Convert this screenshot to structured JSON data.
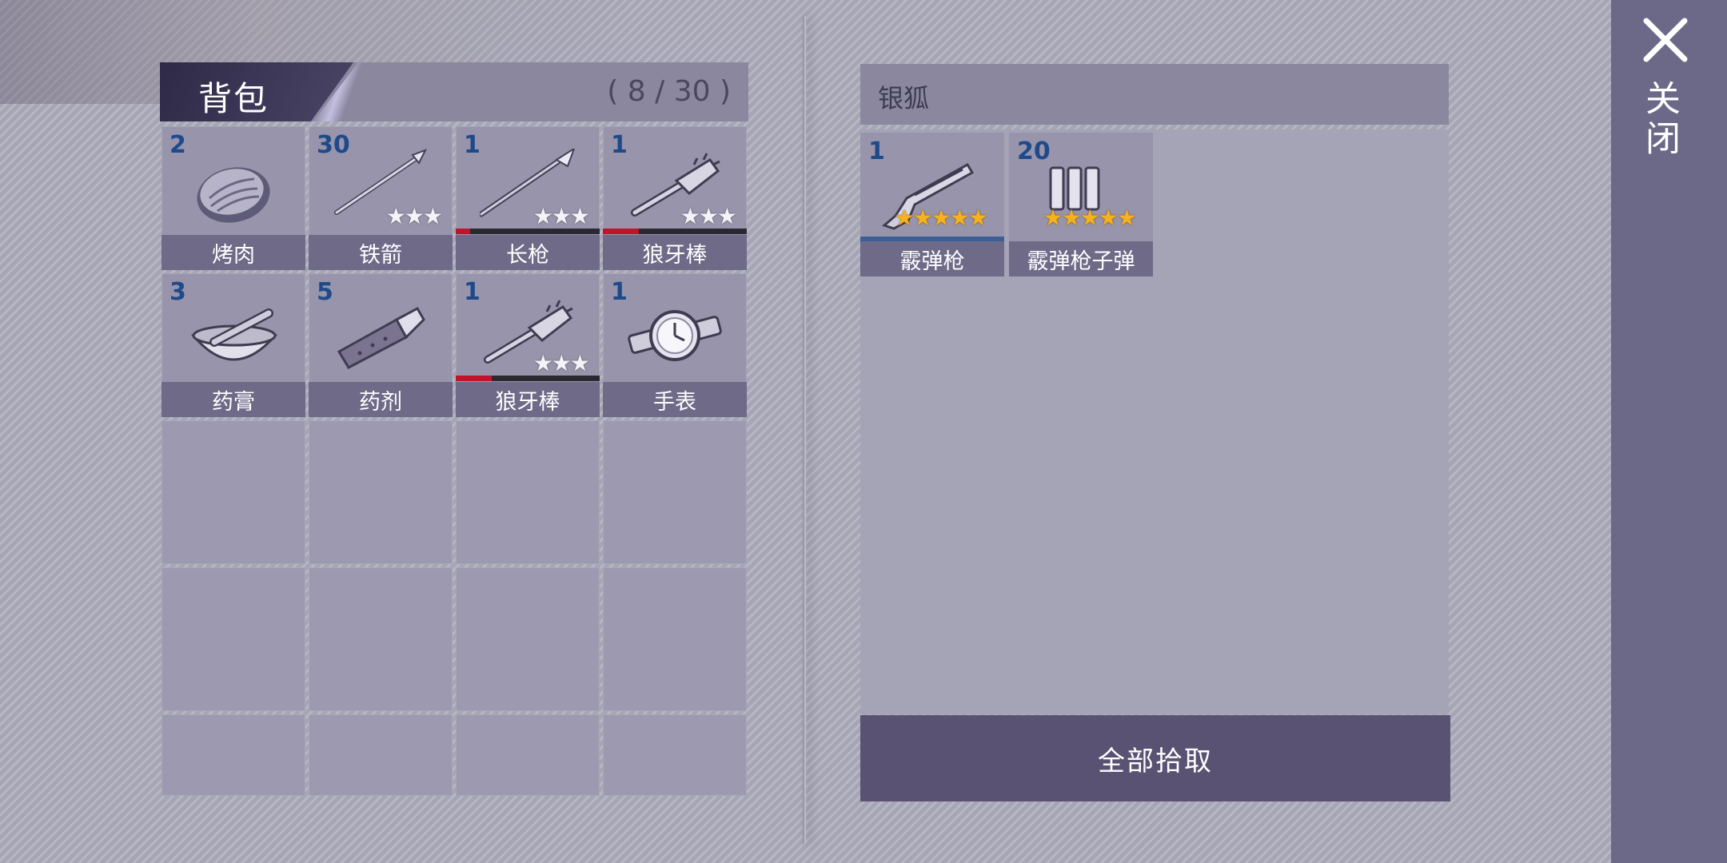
{
  "backpack": {
    "title": "背包",
    "count": "( 8 / 30 )",
    "items": [
      {
        "qty": "2",
        "name": "烤肉",
        "icon": "grilled-meat-icon",
        "stars": "",
        "durability": null
      },
      {
        "qty": "30",
        "name": "铁箭",
        "icon": "iron-arrow-icon",
        "stars": "★★★",
        "durability": null
      },
      {
        "qty": "1",
        "name": "长枪",
        "icon": "spear-icon",
        "stars": "★★★",
        "durability": 0.1
      },
      {
        "qty": "1",
        "name": "狼牙棒",
        "icon": "spiked-club-icon",
        "stars": "★★★",
        "durability": 0.25
      },
      {
        "qty": "3",
        "name": "药膏",
        "icon": "ointment-bowl-icon",
        "stars": "",
        "durability": null
      },
      {
        "qty": "5",
        "name": "药剂",
        "icon": "medicine-bandage-icon",
        "stars": "",
        "durability": null
      },
      {
        "qty": "1",
        "name": "狼牙棒",
        "icon": "spiked-club-icon",
        "stars": "★★★",
        "durability": 0.25
      },
      {
        "qty": "1",
        "name": "手表",
        "icon": "wristwatch-icon",
        "stars": "",
        "durability": null
      }
    ]
  },
  "loot": {
    "title": "银狐",
    "items": [
      {
        "qty": "1",
        "name": "霰弹枪",
        "icon": "shotgun-icon",
        "stars": "★★★★★"
      },
      {
        "qty": "20",
        "name": "霰弹枪子弹",
        "icon": "shotgun-shells-icon",
        "stars": "★★★★★"
      }
    ],
    "pickup_all_label": "全部拾取"
  },
  "close": {
    "label": "关闭",
    "icon": "close-icon"
  },
  "colors": {
    "quantity_text": "#1f4a8a",
    "durability_red": "#c0142a",
    "star_gold": "#f5b21c",
    "button_bg": "#5a5272"
  }
}
